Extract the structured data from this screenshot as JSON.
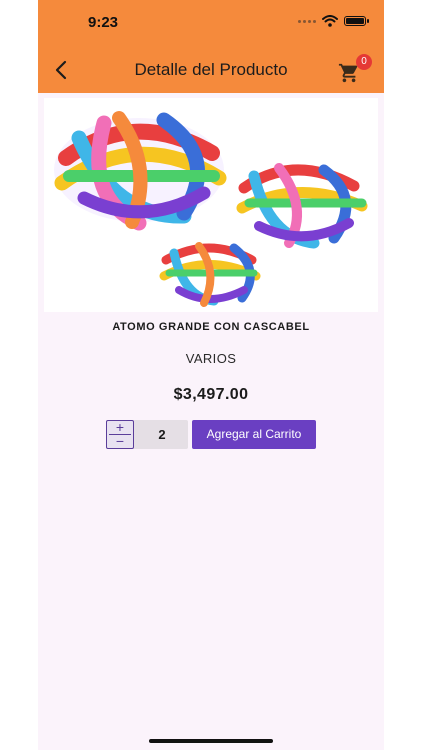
{
  "status_bar": {
    "time": "9:23"
  },
  "app_bar": {
    "title": "Detalle del Producto",
    "cart_count": "0"
  },
  "product": {
    "name": "ATOMO GRANDE CON CASCABEL",
    "brand": "VARIOS",
    "price": "$3,497.00",
    "quantity": "2"
  },
  "actions": {
    "plus": "+",
    "minus": "−",
    "add_to_cart": "Agregar al Carrito"
  },
  "colors": {
    "app_bar": "#f58a3c",
    "accent": "#6a3fc2",
    "badge": "#e53935",
    "background": "#fbf3fb"
  },
  "icons": [
    "back-arrow-icon",
    "shopping-cart-icon",
    "wifi-icon",
    "battery-icon"
  ]
}
